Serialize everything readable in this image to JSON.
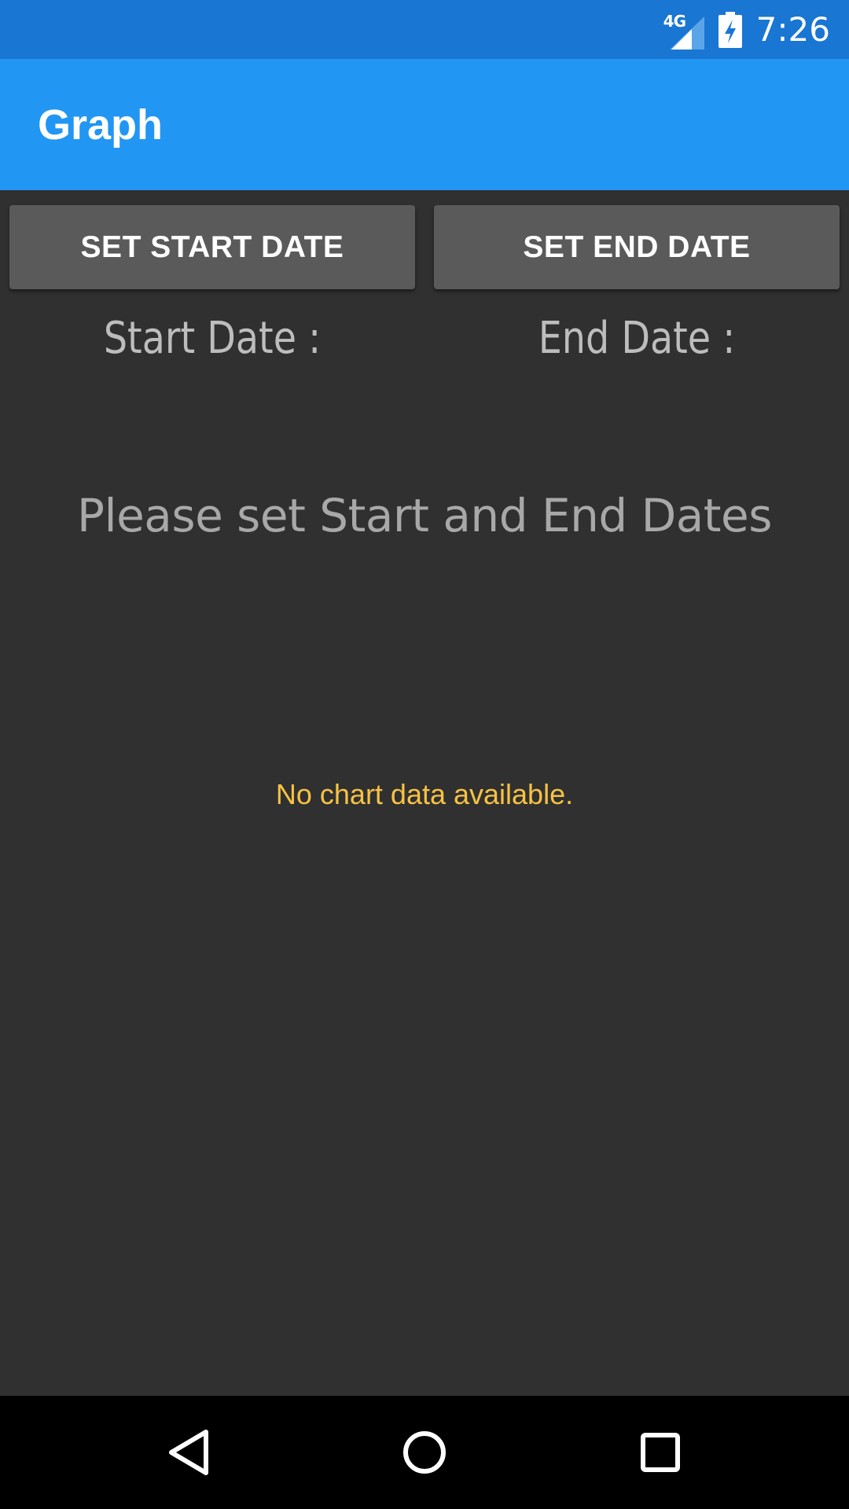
{
  "status_bar": {
    "network_label": "4G",
    "time": "7:26",
    "icons": [
      "signal-icon",
      "battery-charging-icon"
    ]
  },
  "app_bar": {
    "title": "Graph"
  },
  "buttons": {
    "set_start_date": "SET START DATE",
    "set_end_date": "SET END DATE"
  },
  "dates": {
    "start_label": "Start Date :",
    "end_label": "End Date :"
  },
  "prompt": "Please set Start and End Dates",
  "chart": {
    "empty_message": "No chart data available."
  },
  "nav_bar": {
    "icons": [
      "back-icon",
      "home-icon",
      "recent-apps-icon"
    ]
  },
  "colors": {
    "status_bar": "#1976D2",
    "app_bar": "#2196F3",
    "background": "#303030",
    "button": "#5A5A5B",
    "empty_message": "#F7C244"
  }
}
